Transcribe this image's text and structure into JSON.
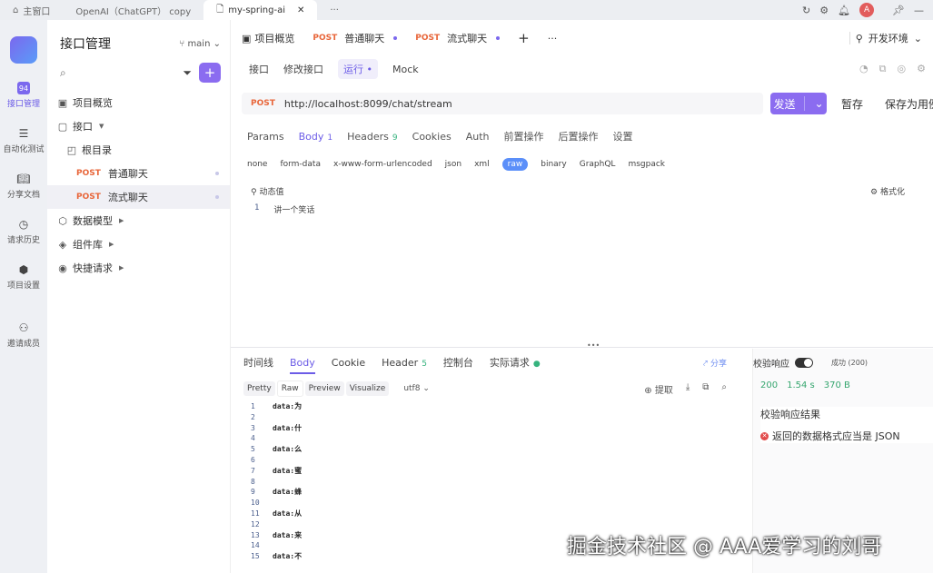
{
  "titlebar": {
    "tabs": [
      {
        "label": "主窗口"
      },
      {
        "label": "OpenAI（ChatGPT） copy"
      },
      {
        "label": "my-spring-ai"
      }
    ],
    "more": "···",
    "avatar": "A"
  },
  "leftnav": {
    "items": [
      {
        "label": "接口管理",
        "icon": "api-icon"
      },
      {
        "label": "自动化测试",
        "icon": "test-icon"
      },
      {
        "label": "分享文档",
        "icon": "doc-icon"
      },
      {
        "label": "请求历史",
        "icon": "clock-icon"
      },
      {
        "label": "项目设置",
        "icon": "gear-icon"
      },
      {
        "label": "邀请成员",
        "icon": "add-user-icon"
      }
    ]
  },
  "sidebar": {
    "title": "接口管理",
    "branch": "main",
    "tree": [
      {
        "label": "项目概览",
        "icon": "▣",
        "level": 0
      },
      {
        "label": "接口",
        "icon": "▢",
        "level": 0,
        "caret": true
      },
      {
        "label": "根目录",
        "icon": "◰",
        "level": 1
      },
      {
        "label": "普通聊天",
        "method": "POST",
        "level": 2
      },
      {
        "label": "流式聊天",
        "method": "POST",
        "level": 2,
        "selected": true
      },
      {
        "label": "数据模型",
        "icon": "⬡",
        "level": 0,
        "caret": true
      },
      {
        "label": "组件库",
        "icon": "◈",
        "level": 0,
        "caret": true
      },
      {
        "label": "快捷请求",
        "icon": "◉",
        "level": 0,
        "caret": true
      }
    ]
  },
  "main": {
    "doc_tabs": [
      {
        "label": "项目概览"
      },
      {
        "method": "POST",
        "label": "普通聊天"
      },
      {
        "method": "POST",
        "label": "流式聊天"
      }
    ],
    "add": "+",
    "more": "···",
    "env": "开发环境",
    "sub_tabs": [
      "接口",
      "修改接口",
      "运行",
      "Mock"
    ],
    "url": {
      "method": "POST",
      "value": "http://localhost:8099/chat/stream"
    },
    "send": "发送",
    "save": "暂存",
    "save_as_case": "保存为用例",
    "req_tabs": [
      {
        "label": "Params"
      },
      {
        "label": "Body",
        "badge": "1"
      },
      {
        "label": "Headers",
        "badge": "9"
      },
      {
        "label": "Cookies"
      },
      {
        "label": "Auth"
      },
      {
        "label": "前置操作"
      },
      {
        "label": "后置操作"
      },
      {
        "label": "设置"
      }
    ],
    "body_types": [
      "none",
      "form-data",
      "x-www-form-urlencoded",
      "json",
      "xml",
      "raw",
      "binary",
      "GraphQL",
      "msgpack"
    ],
    "dynamic_value": "动态值",
    "format": "格式化",
    "editor": {
      "line": "1",
      "text": "讲一个笑话"
    }
  },
  "response": {
    "tabs": [
      {
        "label": "时间线"
      },
      {
        "label": "Body"
      },
      {
        "label": "Cookie"
      },
      {
        "label": "Header",
        "badge": "5"
      },
      {
        "label": "控制台"
      },
      {
        "label": "实际请求"
      }
    ],
    "share": "分享",
    "views": [
      "Pretty",
      "Raw",
      "Preview",
      "Visualize"
    ],
    "encoding": "utf8",
    "extract": "提取",
    "lines": [
      {
        "n": "1",
        "t": "data:为"
      },
      {
        "n": "2",
        "t": ""
      },
      {
        "n": "3",
        "t": "data:什"
      },
      {
        "n": "4",
        "t": ""
      },
      {
        "n": "5",
        "t": "data:么"
      },
      {
        "n": "6",
        "t": ""
      },
      {
        "n": "7",
        "t": "data:蜜"
      },
      {
        "n": "8",
        "t": ""
      },
      {
        "n": "9",
        "t": "data:蜂"
      },
      {
        "n": "10",
        "t": ""
      },
      {
        "n": "11",
        "t": "data:从"
      },
      {
        "n": "12",
        "t": ""
      },
      {
        "n": "13",
        "t": "data:来"
      },
      {
        "n": "14",
        "t": ""
      },
      {
        "n": "15",
        "t": "data:不"
      }
    ]
  },
  "verify": {
    "label": "校验响应",
    "success": "成功 (200)",
    "status": "200",
    "time": "1.54 s",
    "size": "370 B",
    "result_title": "校验响应结果",
    "error": "返回的数据格式应当是 JSON"
  },
  "watermark": "掘金技术社区 @ AAA爱学习的刘哥",
  "colors": {
    "accent": "#8b6cf0",
    "post": "#e8663a",
    "success": "#36a66f",
    "error": "#e24b4b"
  }
}
